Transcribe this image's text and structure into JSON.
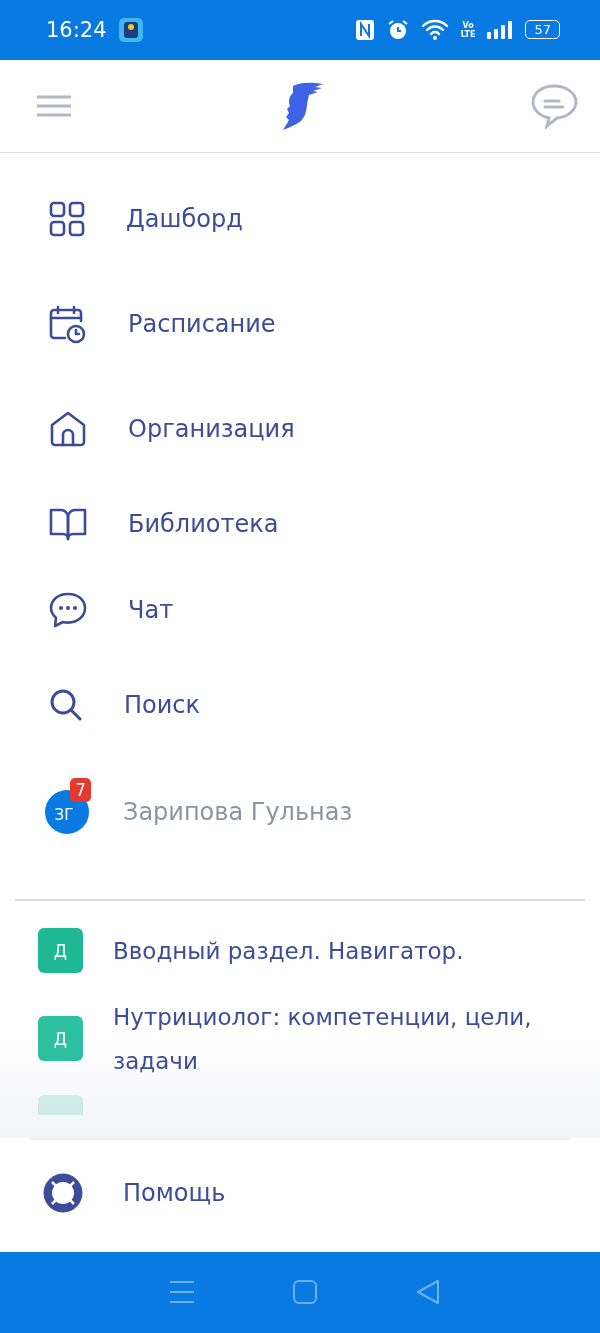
{
  "status_bar": {
    "time": "16:24",
    "network": [
      "Vo",
      "LTE"
    ],
    "battery": "57"
  },
  "menu": [
    {
      "kind": "dashboard",
      "label": "Дашборд"
    },
    {
      "kind": "calendar",
      "label": "Расписание"
    },
    {
      "kind": "home",
      "label": "Организация"
    },
    {
      "kind": "book",
      "label": "Библиотека"
    },
    {
      "kind": "chat",
      "label": "Чат"
    },
    {
      "kind": "search",
      "label": "Поиск"
    }
  ],
  "user": {
    "initials": "ЗГ",
    "badge": "7",
    "name": "Зарипова Гульназ"
  },
  "courses": [
    {
      "letter": "Д",
      "title": "Вводный раздел. Навигатор.",
      "color": "#1fb894"
    },
    {
      "letter": "Д",
      "title": "Нутрициолог: компетенции, цели, задачи",
      "color": "#2cc0a0"
    }
  ],
  "help": {
    "label": "Помощь"
  }
}
